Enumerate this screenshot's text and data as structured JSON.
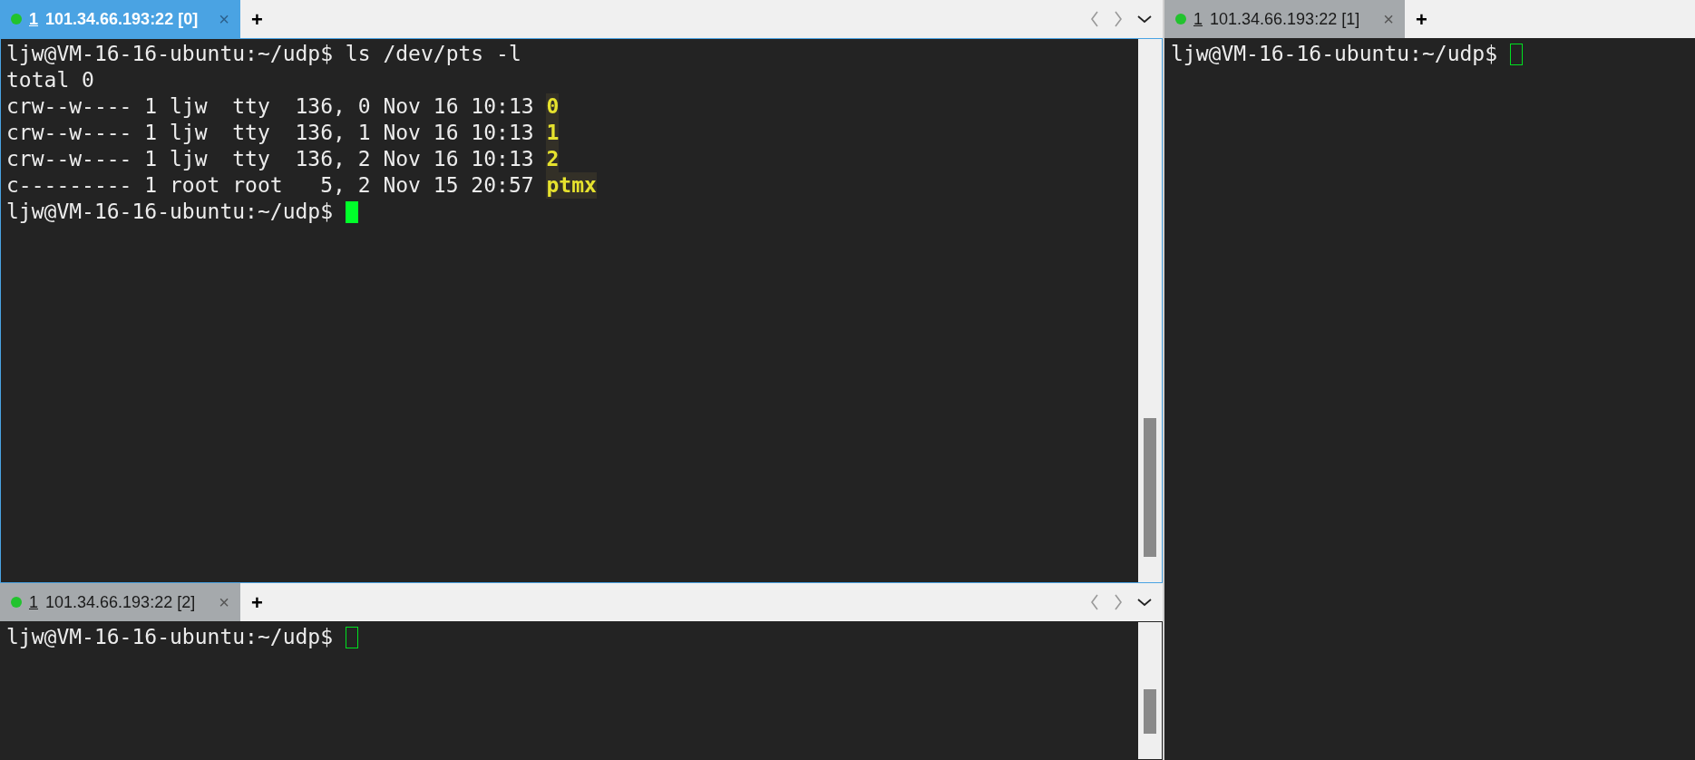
{
  "panes": [
    {
      "tab": {
        "number": "1",
        "title": "101.34.66.193:22 [0]",
        "selected": true,
        "close": "×"
      },
      "new_tab": "+",
      "nav": true,
      "active": true,
      "scrollbar": true,
      "cursor_filled": true,
      "lines": [
        [
          {
            "text": "ljw@VM-16-16-ubuntu:~/udp$ ls /dev/pts -l",
            "kind": "plain"
          }
        ],
        [
          {
            "text": "total 0",
            "kind": "plain"
          }
        ],
        [
          {
            "text": "crw--w---- 1 ljw  tty  136, 0 Nov 16 10:13 ",
            "kind": "plain"
          },
          {
            "text": "0",
            "kind": "highlight"
          }
        ],
        [
          {
            "text": "crw--w---- 1 ljw  tty  136, 1 Nov 16 10:13 ",
            "kind": "plain"
          },
          {
            "text": "1",
            "kind": "highlight"
          }
        ],
        [
          {
            "text": "crw--w---- 1 ljw  tty  136, 2 Nov 16 10:13 ",
            "kind": "plain"
          },
          {
            "text": "2",
            "kind": "highlight"
          }
        ],
        [
          {
            "text": "c--------- 1 root root   5, 2 Nov 15 20:57 ",
            "kind": "plain"
          },
          {
            "text": "ptmx",
            "kind": "highlight"
          }
        ],
        [
          {
            "text": "ljw@VM-16-16-ubuntu:~/udp$ ",
            "kind": "plain"
          }
        ]
      ]
    },
    {
      "tab": {
        "number": "1",
        "title": "101.34.66.193:22 [2]",
        "selected": false,
        "close": "×"
      },
      "new_tab": "+",
      "nav": true,
      "active": false,
      "scrollbar": true,
      "cursor_filled": false,
      "lines": [
        [
          {
            "text": "ljw@VM-16-16-ubuntu:~/udp$ ",
            "kind": "plain"
          }
        ]
      ]
    },
    {
      "tab": {
        "number": "1",
        "title": "101.34.66.193:22 [1]",
        "selected": false,
        "close": "×"
      },
      "new_tab": "+",
      "nav": false,
      "active": false,
      "scrollbar": false,
      "cursor_filled": false,
      "lines": [
        [
          {
            "text": "ljw@VM-16-16-ubuntu:~/udp$ ",
            "kind": "plain"
          }
        ]
      ]
    }
  ]
}
